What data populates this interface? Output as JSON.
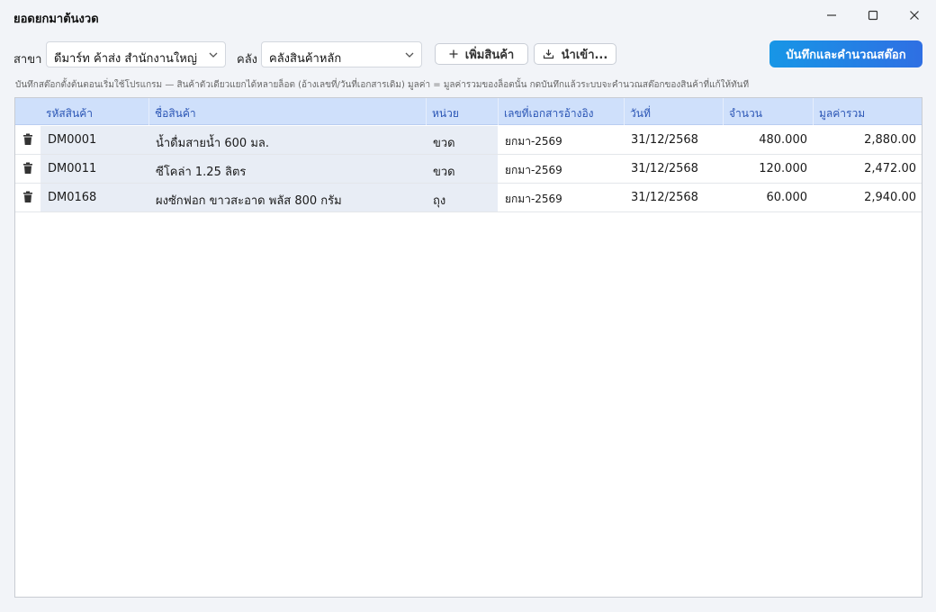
{
  "window": {
    "title": "ยอดยกมาต้นงวด"
  },
  "toolbar": {
    "branch_label": "สาขา",
    "branch_value": "ดีมาร์ท ค้าส่ง สำนักงานใหญ่",
    "warehouse_label": "คลัง",
    "warehouse_value": "คลังสินค้าหลัก",
    "add_product_label": "เพิ่มสินค้า",
    "import_label": "นำเข้า...",
    "save_label": "บันทึกและคำนวณสต๊อก"
  },
  "hint": "บันทึกสต๊อกตั้งต้นตอนเริ่มใช้โปรแกรม — สินค้าตัวเดียวแยกได้หลายล็อต (อ้างเลขที่/วันที่เอกสารเดิม) มูลค่า = มูลค่ารวมของล็อตนั้น กดบันทึกแล้วระบบจะคำนวณสต๊อกของสินค้าที่แก้ให้ทันที",
  "table": {
    "columns": [
      "รหัสสินค้า",
      "ชื่อสินค้า",
      "หน่วย",
      "เลขที่เอกสารอ้างอิง",
      "วันที่",
      "จำนวน",
      "มูลค่ารวม"
    ],
    "rows": [
      [
        "DM0001",
        "น้ำดื่มสายน้ำ 600 มล.",
        "ขวด",
        "ยกมา-2569",
        "31/12/2568",
        "480.000",
        "2,880.00"
      ],
      [
        "DM0011",
        "ซีโคล่า 1.25 ลิตร",
        "ขวด",
        "ยกมา-2569",
        "31/12/2568",
        "120.000",
        "2,472.00"
      ],
      [
        "DM0168",
        "ผงซักฟอก ขาวสะอาด พลัส 800 กรัม",
        "ถุง",
        "ยกมา-2569",
        "31/12/2568",
        "60.000",
        "2,940.00"
      ]
    ]
  },
  "icons": {
    "minimize": "minimize-icon",
    "maximize": "maximize-icon",
    "close": "close-icon",
    "delete": "trash-icon",
    "add": "plus-icon",
    "import": "import-icon",
    "dropdown": "chevron-down-icon"
  },
  "colors": {
    "accent": "#1e88e5",
    "header_bg": "#cfe0fb",
    "header_text": "#2a55b5",
    "row_shade": "#e8edf5"
  }
}
